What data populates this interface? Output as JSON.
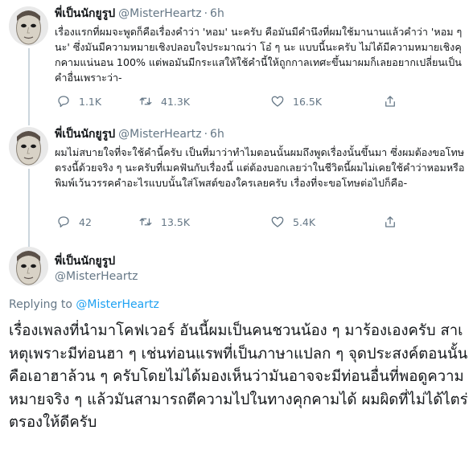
{
  "colors": {
    "text": "#14171a",
    "muted": "#657786",
    "link": "#1da1f2",
    "thread_line": "#ccd6dd",
    "divider": "#e6ecf0"
  },
  "tweets": [
    {
      "display_name": "พี่เป็นนักยูรูป",
      "handle": "@MisterHeartz",
      "separator": "·",
      "time": "6h",
      "text": "เรื่องแรกที่ผมจะพูดก็คือเรื่องคำว่า 'หอม' นะครับ คือมันมีคำนึงที่ผมใช้มานานแล้วคำว่า 'หอม ๆ นะ' ซึ่งมันมีความหมายเชิงปลอบใจประมาณว่า โอ๋ ๆ นะ แบบนี้นะครับ ไม่ได้มีความหมายเชิงคุกคามแน่นอน 100% แต่พอมันมีกระแสให้ใช้คำนี้ให้ถูกกาลเทศะขึ้นมาผมก็เลยอยากเปลี่ยนเป็นคำอื่นเพราะว่า-",
      "actions": {
        "reply_icon": "reply-icon",
        "reply_count": "1.1K",
        "retweet_icon": "retweet-icon",
        "retweet_count": "41.3K",
        "like_icon": "heart-icon",
        "like_count": "16.5K",
        "share_icon": "share-icon"
      }
    },
    {
      "display_name": "พี่เป็นนักยูรูป",
      "handle": "@MisterHeartz",
      "separator": "·",
      "time": "6h",
      "text": "ผมไม่สบายใจที่จะใช้คำนี้ครับ เป็นที่มาว่าทำไมตอนนั้นผมถึงพูดเรื่องนั้นขึ้นมา ซึ่งผมต้องขอโทษตรงนี้ด้วยจริง ๆ นะครับที่เมคฟันกับเรื่องนี้ แต่ต้องบอกเลยว่าในชีวิตนี้ผมไม่เคยใช้คำว่าหอมหรือพิมพ์เว้นวรรคคำอะไรแบบนั้นใส่โพสต์ของใครเลยครับ เรื่องที่จะขอโทษต่อไปก็คือ-",
      "actions": {
        "reply_icon": "reply-icon",
        "reply_count": "42",
        "retweet_icon": "retweet-icon",
        "retweet_count": "13.5K",
        "like_icon": "heart-icon",
        "like_count": "5.4K",
        "share_icon": "share-icon"
      }
    }
  ],
  "main_tweet": {
    "display_name": "พี่เป็นนักยูรูป",
    "handle": "@MisterHeartz",
    "replying_prefix": "Replying to",
    "replying_to": "@MisterHeartz",
    "text": "เรื่องเพลงที่นำมาโคฟเวอร์ อันนี้ผมเป็นคนชวนน้อง ๆ มาร้องเองครับ สาเหตุเพราะมีท่อนฮา ๆ เช่นท่อนแรพที่เป็นภาษาแปลก ๆ จุดประสงค์ตอนนั้นคือเอาฮาล้วน ๆ ครับโดยไม่ได้มองเห็นว่ามันอาจจะมีท่อนอื่นที่พอดูความหมายจริง ๆ แล้วมันสามารถตีความไปในทางคุกคามได้ ผมผิดที่ไม่ได้ไตร่ตรองให้ดีครับ"
  }
}
